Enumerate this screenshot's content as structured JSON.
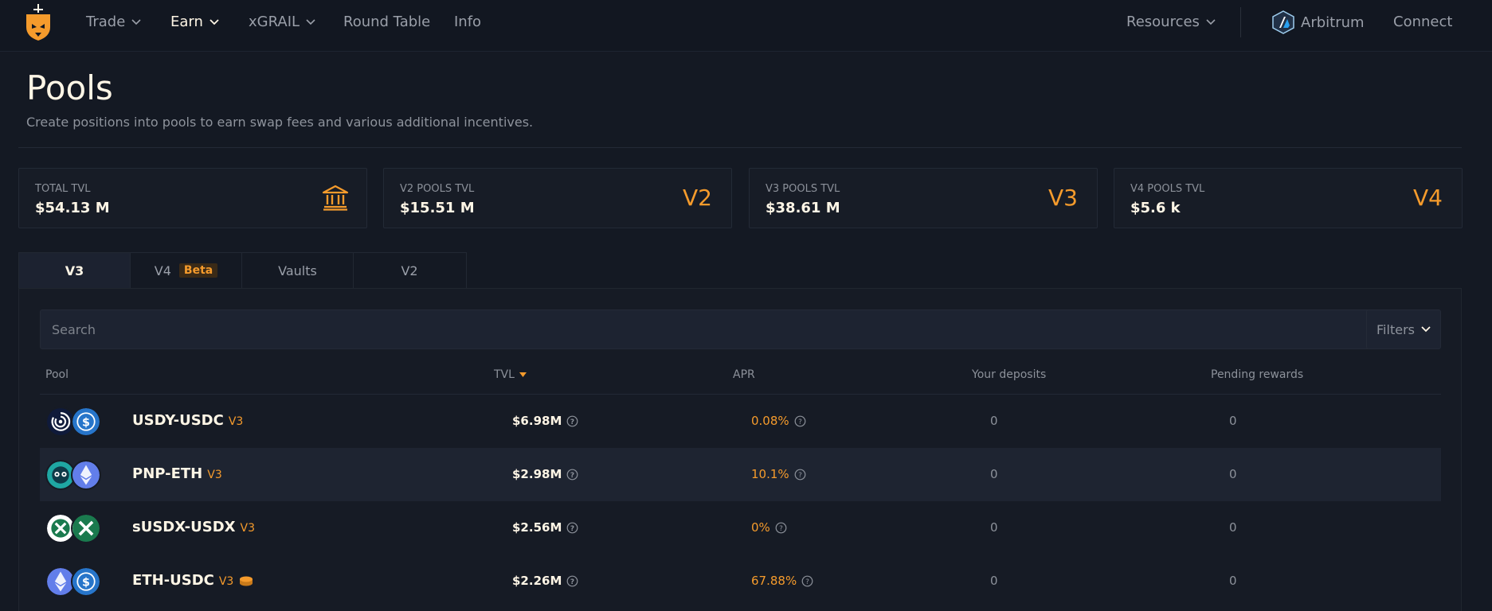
{
  "nav": {
    "items": [
      {
        "label": "Trade",
        "has_dropdown": true,
        "active": false
      },
      {
        "label": "Earn",
        "has_dropdown": true,
        "active": true
      },
      {
        "label": "xGRAIL",
        "has_dropdown": true,
        "active": false
      },
      {
        "label": "Round Table",
        "has_dropdown": false,
        "active": false
      },
      {
        "label": "Info",
        "has_dropdown": false,
        "active": false
      }
    ],
    "resources": "Resources",
    "network": "Arbitrum",
    "connect": "Connect"
  },
  "header": {
    "title": "Pools",
    "subtitle": "Create positions into pools to earn swap fees and various additional incentives."
  },
  "stats": [
    {
      "label": "TOTAL TVL",
      "value": "$54.13 M",
      "icon": "bank-icon"
    },
    {
      "label": "V2 POOLS TVL",
      "value": "$15.51 M",
      "tag": "V2"
    },
    {
      "label": "V3 POOLS TVL",
      "value": "$38.61 M",
      "tag": "V3"
    },
    {
      "label": "V4 POOLS TVL",
      "value": "$5.6 k",
      "tag": "V4"
    }
  ],
  "tabs": [
    {
      "label": "V3",
      "active": true
    },
    {
      "label": "V4",
      "badge": "Beta",
      "active": false
    },
    {
      "label": "Vaults",
      "active": false
    },
    {
      "label": "V2",
      "active": false
    }
  ],
  "search": {
    "placeholder": "Search",
    "value": ""
  },
  "filters_label": "Filters",
  "table": {
    "columns": [
      "Pool",
      "TVL",
      "APR",
      "Your deposits",
      "Pending rewards"
    ],
    "sorted_by": "TVL",
    "rows": [
      {
        "pool": "USDY-USDC",
        "version": "V3",
        "tvl": "$6.98M",
        "apr": "0.08%",
        "deposits": "0",
        "rewards": "0"
      },
      {
        "pool": "PNP-ETH",
        "version": "V3",
        "tvl": "$2.98M",
        "apr": "10.1%",
        "deposits": "0",
        "rewards": "0"
      },
      {
        "pool": "sUSDX-USDX",
        "version": "V3",
        "tvl": "$2.56M",
        "apr": "0%",
        "deposits": "0",
        "rewards": "0"
      },
      {
        "pool": "ETH-USDC",
        "version": "V3",
        "tvl": "$2.26M",
        "apr": "67.88%",
        "deposits": "0",
        "rewards": "0"
      }
    ]
  },
  "colors": {
    "accent": "#f59b2c",
    "background": "#141923",
    "text": "#fff6e6",
    "muted": "#8c919a"
  }
}
